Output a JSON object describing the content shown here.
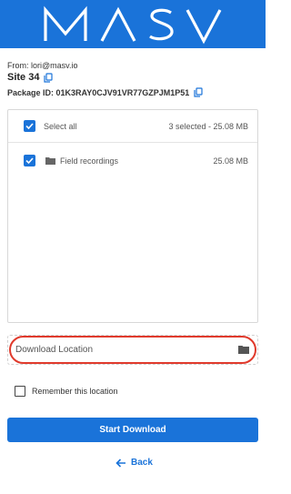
{
  "brand": {
    "logo_text": "MASV",
    "header_color": "#1a73d9"
  },
  "package": {
    "from": "From: lori@masv.io",
    "title": "Site 34",
    "package_id": "Package ID: 01K3RAY0CJV91VR77GZPJM1P51"
  },
  "file_list": {
    "select_all_label": "Select all",
    "select_all_checked": true,
    "summary": "3 selected - 25.08 MB",
    "items": [
      {
        "name": "Field recordings",
        "size": "25.08 MB",
        "checked": true,
        "icon": "folder-icon"
      }
    ]
  },
  "download_location": {
    "placeholder": "Download Location",
    "highlight_color": "#e03a2c",
    "icon": "folder-icon"
  },
  "remember": {
    "label": "Remember this location",
    "checked": false
  },
  "actions": {
    "start_label": "Start Download",
    "back_label": "Back"
  }
}
